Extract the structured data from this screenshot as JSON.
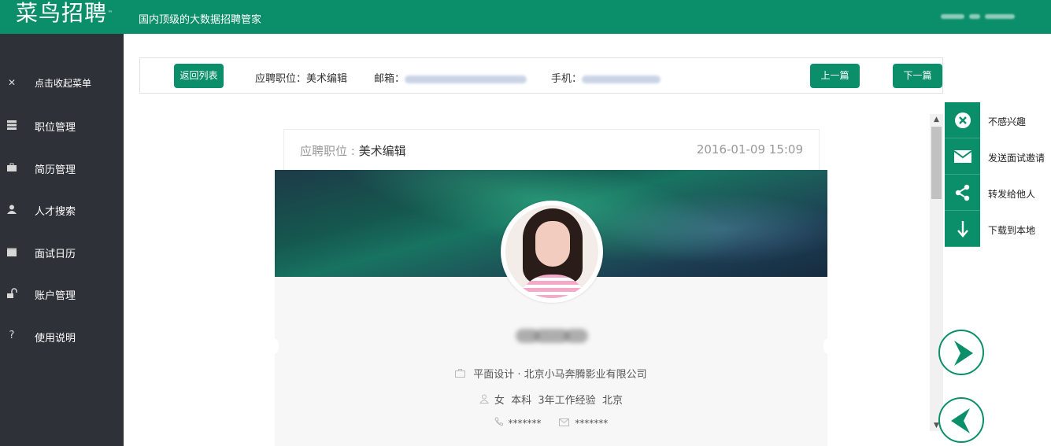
{
  "header": {
    "logo": "菜鸟招聘",
    "logo_tm": "™",
    "slogan": "国内顶级的大数据招聘管家"
  },
  "sidebar": {
    "items": [
      {
        "label": "点击收起菜单",
        "icon": "collapse-icon"
      },
      {
        "label": "职位管理",
        "icon": "server-icon"
      },
      {
        "label": "简历管理",
        "icon": "briefcase-icon"
      },
      {
        "label": "人才搜索",
        "icon": "user-icon"
      },
      {
        "label": "面试日历",
        "icon": "calendar-icon"
      },
      {
        "label": "账户管理",
        "icon": "unlock-icon"
      },
      {
        "label": "使用说明",
        "icon": "question-icon"
      }
    ]
  },
  "toolbar": {
    "back_label": "返回列表",
    "position_label": "应聘职位：",
    "position_value": "美术编辑",
    "email_label": "邮箱：",
    "phone_label": "手机：",
    "prev_label": "上一篇",
    "next_label": "下一篇"
  },
  "resume": {
    "position_label": "应聘职位 : ",
    "position_value": "美术编辑",
    "date": "2016-01-09 15:09",
    "job_line": "平面设计 · 北京小马奔腾影业有限公司",
    "gender": "女",
    "education": "本科",
    "experience": "3年工作经验",
    "city": "北京",
    "phone_masked": "*******",
    "email_masked": "*******"
  },
  "actions": [
    {
      "label": "不感兴趣",
      "icon": "close-circle-icon"
    },
    {
      "label": "发送面试邀请",
      "icon": "envelope-icon"
    },
    {
      "label": "转发给他人",
      "icon": "share-icon"
    },
    {
      "label": "下载到本地",
      "icon": "download-arrow-icon"
    }
  ],
  "colors": {
    "brand": "#0b8f6a",
    "sidebar": "#2e3238"
  }
}
